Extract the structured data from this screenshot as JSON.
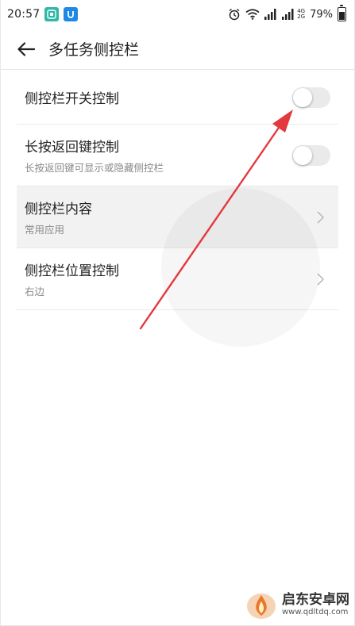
{
  "status_bar": {
    "time": "20:57",
    "network": [
      "4G",
      "2G"
    ],
    "battery_percent": "79%",
    "battery_level": 0.79,
    "icons": [
      "screenshot-app-icon",
      "u-app-icon",
      "alarm-icon",
      "wifi-icon",
      "signal-icon",
      "signal-icon",
      "battery-icon"
    ]
  },
  "header": {
    "back_icon": "back-arrow-icon",
    "title": "多任务侧控栏"
  },
  "settings": [
    {
      "title": "侧控栏开关控制",
      "subtitle": "",
      "control": "toggle",
      "on": false
    },
    {
      "title": "长按返回键控制",
      "subtitle": "长按返回键可显示或隐藏侧控栏",
      "control": "toggle",
      "on": false
    },
    {
      "title": "侧控栏内容",
      "subtitle": "常用应用",
      "control": "chevron"
    },
    {
      "title": "侧控栏位置控制",
      "subtitle": "右边",
      "control": "chevron"
    }
  ],
  "colors": {
    "annotation_arrow": "#e2393f",
    "toggle_track_off": "#eaeaea",
    "app_badge_1": "#2fb8a8",
    "app_badge_2": "#1e88e5"
  },
  "watermark": {
    "name": "启东安卓网",
    "url": "www.qdltdq.com"
  }
}
